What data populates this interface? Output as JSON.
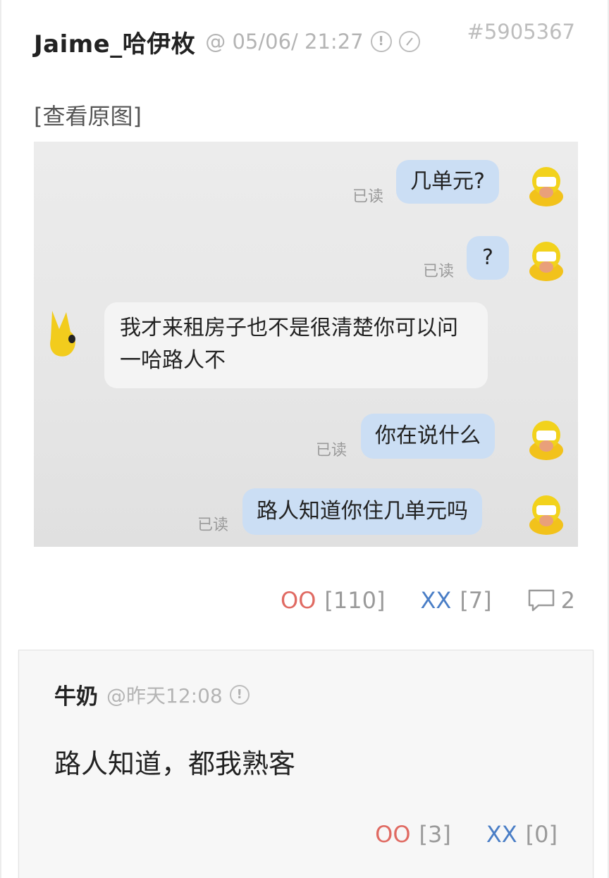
{
  "post": {
    "author": "Jaime_哈伊枚",
    "meta": "@ 05/06/ 21:27",
    "id": "#5905367",
    "view_original": "[查看原图]",
    "report_icon": "exclamation-circle-icon",
    "block_icon": "slash-circle-icon"
  },
  "chat": {
    "read_label": "已读",
    "messages": [
      {
        "side": "me",
        "text": "几单元?"
      },
      {
        "side": "me",
        "text": "?"
      },
      {
        "side": "them",
        "text": "我才来租房子也不是很清楚你可以问一哈路人不"
      },
      {
        "side": "me",
        "text": "你在说什么"
      },
      {
        "side": "me",
        "text": "路人知道你住几单元吗"
      }
    ]
  },
  "actions": {
    "oo_label": "OO",
    "oo_count": "[110]",
    "xx_label": "XX",
    "xx_count": "[7]",
    "comment_count": "2"
  },
  "comment": {
    "author": "牛奶",
    "meta": "@昨天12:08",
    "text": "路人知道，都我熟客",
    "oo_label": "OO",
    "oo_count": "[3]",
    "xx_label": "XX",
    "xx_count": "[0]"
  },
  "colors": {
    "oo": "#e06a62",
    "xx": "#4a7ec6",
    "bubble_me": "#cbdef4",
    "bubble_them": "#f4f4f4"
  }
}
